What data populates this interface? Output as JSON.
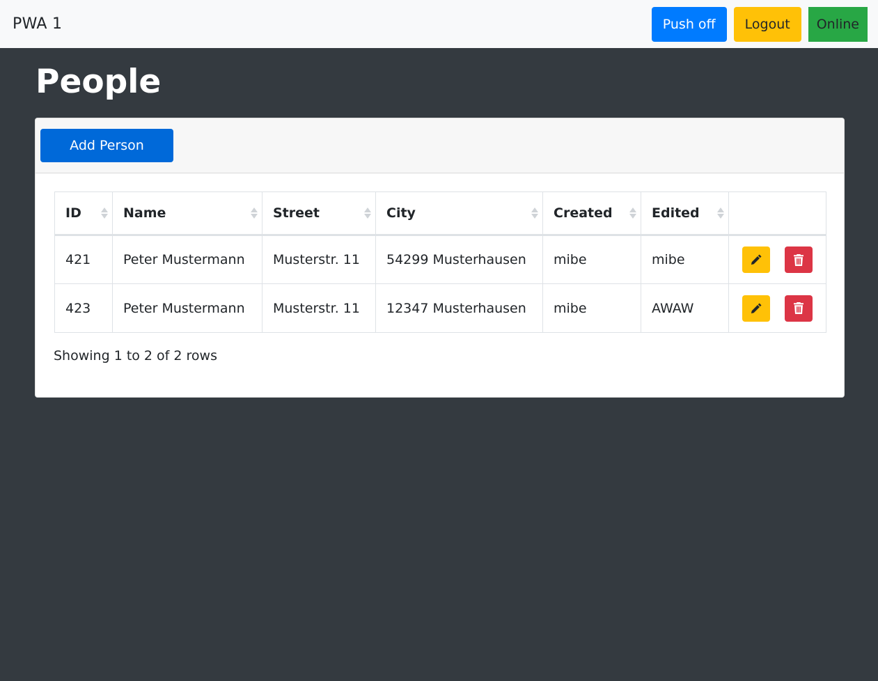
{
  "navbar": {
    "brand": "PWA 1",
    "push_label": "Push off",
    "logout_label": "Logout",
    "status_label": "Online"
  },
  "page": {
    "title": "People"
  },
  "toolbar": {
    "add_label": "Add Person"
  },
  "table": {
    "headers": [
      "ID",
      "Name",
      "Street",
      "City",
      "Created",
      "Edited"
    ],
    "rows": [
      {
        "id": "421",
        "name": "Peter Mustermann",
        "street": "Musterstr. 11",
        "city": "54299 Musterhausen",
        "created": "mibe",
        "edited": "mibe"
      },
      {
        "id": "423",
        "name": "Peter Mustermann",
        "street": "Musterstr. 11",
        "city": "12347 Musterhausen",
        "created": "mibe",
        "edited": "AWAW"
      }
    ]
  },
  "pagination": {
    "info": "Showing 1 to 2 of 2 rows"
  },
  "icons": {
    "edit": "pencil-icon",
    "delete": "trash-icon",
    "sort": "sort-icon"
  },
  "colors": {
    "primary": "#007bff",
    "warning": "#ffc107",
    "success": "#28a745",
    "danger": "#dc3545",
    "background": "#343a40"
  }
}
